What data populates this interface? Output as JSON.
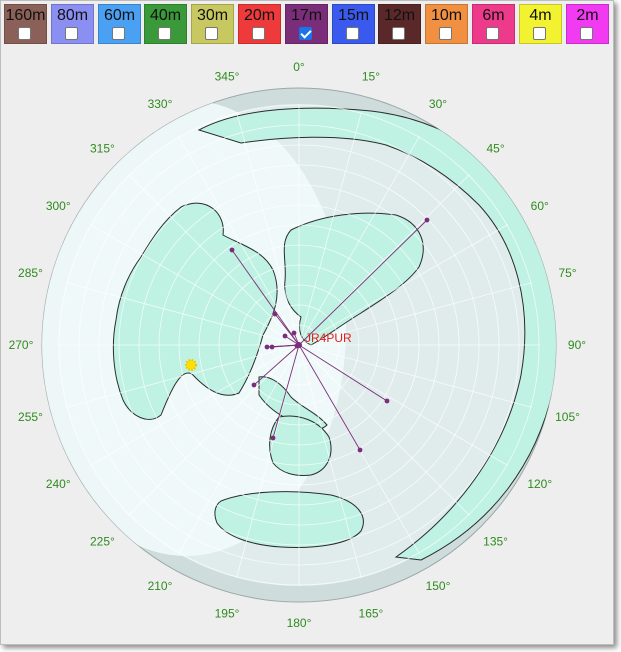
{
  "bands": [
    {
      "label": "160m",
      "color": "#8b6058",
      "checked": false
    },
    {
      "label": "80m",
      "color": "#8c8ff2",
      "checked": false
    },
    {
      "label": "60m",
      "color": "#4aa0f2",
      "checked": false
    },
    {
      "label": "40m",
      "color": "#3a9a3a",
      "checked": false
    },
    {
      "label": "30m",
      "color": "#c8c860",
      "checked": false
    },
    {
      "label": "20m",
      "color": "#ee3a3a",
      "checked": false
    },
    {
      "label": "17m",
      "color": "#7a2e7a",
      "checked": true
    },
    {
      "label": "15m",
      "color": "#3a59ee",
      "checked": false
    },
    {
      "label": "12m",
      "color": "#5a2828",
      "checked": false
    },
    {
      "label": "10m",
      "color": "#f09040",
      "checked": false
    },
    {
      "label": "6m",
      "color": "#ee3a8a",
      "checked": false
    },
    {
      "label": "4m",
      "color": "#f2f230",
      "checked": false
    },
    {
      "label": "2m",
      "color": "#f23af2",
      "checked": false
    }
  ],
  "map": {
    "station_callsign": "JR4PUR",
    "azimuth_labels": [
      "0°",
      "15°",
      "30°",
      "45°",
      "60°",
      "75°",
      "90°",
      "105°",
      "120°",
      "135°",
      "150°",
      "165°",
      "180°",
      "195°",
      "210°",
      "225°",
      "240°",
      "255°",
      "270°",
      "285°",
      "300°",
      "315°",
      "330°",
      "345°"
    ],
    "colors": {
      "ocean": "#d2e0e0",
      "land": "#bff2e2",
      "daylight": "#f2fcfc",
      "spots": "#7a2e7a",
      "callsign": "#e02020",
      "labels": "#2e8b1e"
    }
  }
}
